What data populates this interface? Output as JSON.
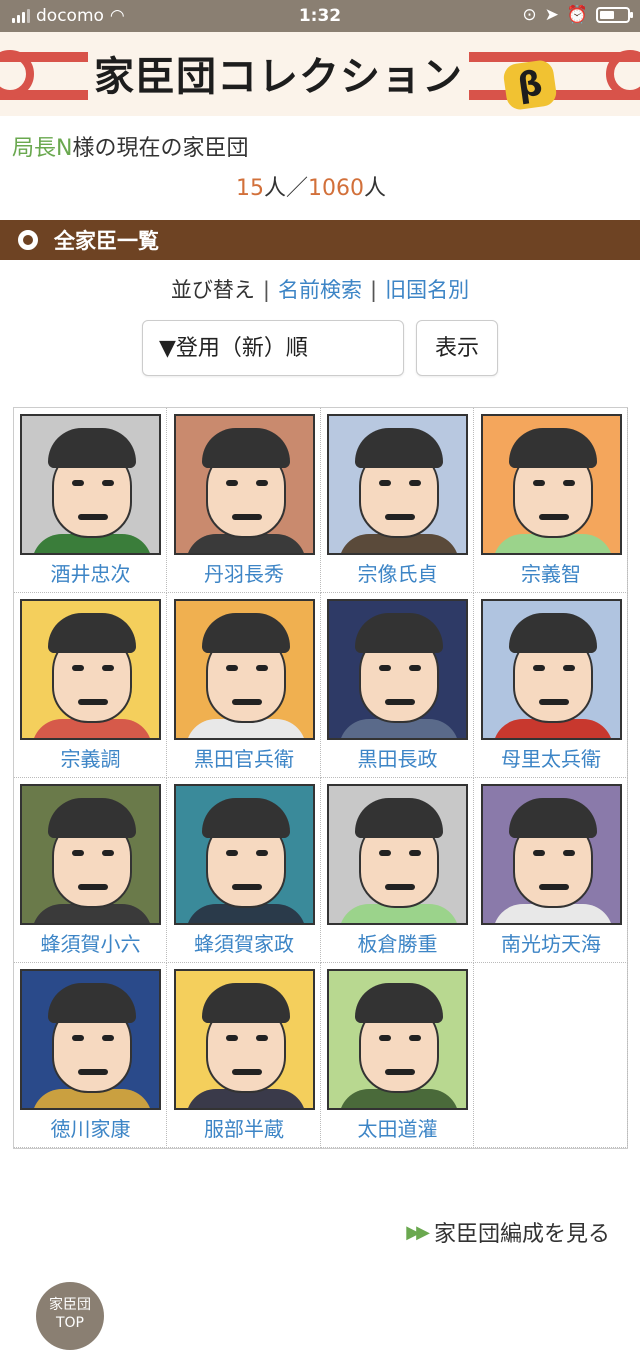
{
  "status_bar": {
    "carrier": "docomo",
    "time": "1:32"
  },
  "banner": {
    "title": "家臣団コレクション",
    "beta": "β"
  },
  "owner": {
    "name": "局長N",
    "suffix": "様の現在の家臣団"
  },
  "count": {
    "current": "15",
    "current_unit": "人／",
    "total": "1060",
    "total_unit": "人"
  },
  "section": {
    "title": "全家臣一覧"
  },
  "sort": {
    "label": "並び替え",
    "sep": "|",
    "search": "名前検索",
    "province": "旧国名別"
  },
  "select": {
    "value": "▼登用（新）順"
  },
  "show_button": "表示",
  "retainers": [
    {
      "name": "酒井忠次",
      "bg": "#c8c8c8",
      "body": "#3a7d3a"
    },
    {
      "name": "丹羽長秀",
      "bg": "#c98a6e",
      "body": "#3a3a3a"
    },
    {
      "name": "宗像氏貞",
      "bg": "#b8c8e0",
      "body": "#5a4a3a"
    },
    {
      "name": "宗義智",
      "bg": "#f4a65c",
      "body": "#9bd38b"
    },
    {
      "name": "宗義調",
      "bg": "#f4cf5c",
      "body": "#d65a4a"
    },
    {
      "name": "黒田官兵衛",
      "bg": "#f0b050",
      "body": "#e8e8e8"
    },
    {
      "name": "黒田長政",
      "bg": "#2e3a66",
      "body": "#5a6a8a"
    },
    {
      "name": "母里太兵衛",
      "bg": "#b0c4e0",
      "body": "#c8382e"
    },
    {
      "name": "蜂須賀小六",
      "bg": "#6a7a4a",
      "body": "#3a3a3a"
    },
    {
      "name": "蜂須賀家政",
      "bg": "#3a8a9a",
      "body": "#2a3a4a"
    },
    {
      "name": "板倉勝重",
      "bg": "#c8c8c8",
      "body": "#9bd38b"
    },
    {
      "name": "南光坊天海",
      "bg": "#8a7aaa",
      "body": "#e8e8e8"
    },
    {
      "name": "徳川家康",
      "bg": "#2a4a8a",
      "body": "#caa040"
    },
    {
      "name": "服部半蔵",
      "bg": "#f4cf5c",
      "body": "#3a3a4a"
    },
    {
      "name": "太田道灌",
      "bg": "#b8d890",
      "body": "#4a6a3a"
    }
  ],
  "formation_link": "家臣団編成を見る",
  "top_button": {
    "line1": "家臣団",
    "line2": "TOP"
  }
}
